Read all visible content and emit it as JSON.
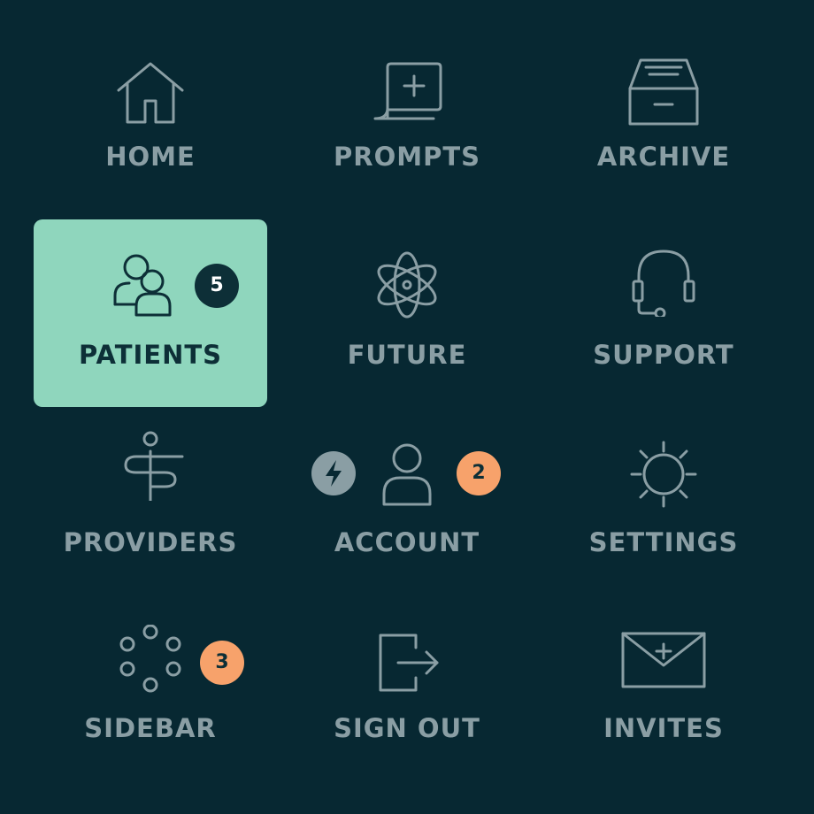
{
  "menu": {
    "home": {
      "label": "HOME",
      "icon": "home-icon"
    },
    "prompts": {
      "label": "PROMPTS",
      "icon": "prompt-add-icon"
    },
    "archive": {
      "label": "ARCHIVE",
      "icon": "archive-box-icon"
    },
    "patients": {
      "label": "PATIENTS",
      "icon": "users-icon",
      "badge": "5",
      "active": true
    },
    "future": {
      "label": "FUTURE",
      "icon": "atom-icon"
    },
    "support": {
      "label": "SUPPORT",
      "icon": "headset-icon"
    },
    "providers": {
      "label": "PROVIDERS",
      "icon": "signpost-icon"
    },
    "account": {
      "label": "ACCOUNT",
      "icon": "user-icon",
      "badge": "2",
      "status_icon": "lightning-icon"
    },
    "settings": {
      "label": "SETTINGS",
      "icon": "sun-gear-icon"
    },
    "sidebar": {
      "label": "SIDEBAR",
      "icon": "dots-circle-icon",
      "badge": "3"
    },
    "sign_out": {
      "label": "SIGN OUT",
      "icon": "sign-out-icon"
    },
    "invites": {
      "label": "INVITES",
      "icon": "envelope-plus-icon"
    }
  },
  "colors": {
    "background": "#072832",
    "icon_text": "#8a9ea4",
    "active_tile": "#8fd6bd",
    "active_text": "#0d2f37",
    "badge_orange": "#f7a26b",
    "badge_dark": "#0d2f37"
  }
}
